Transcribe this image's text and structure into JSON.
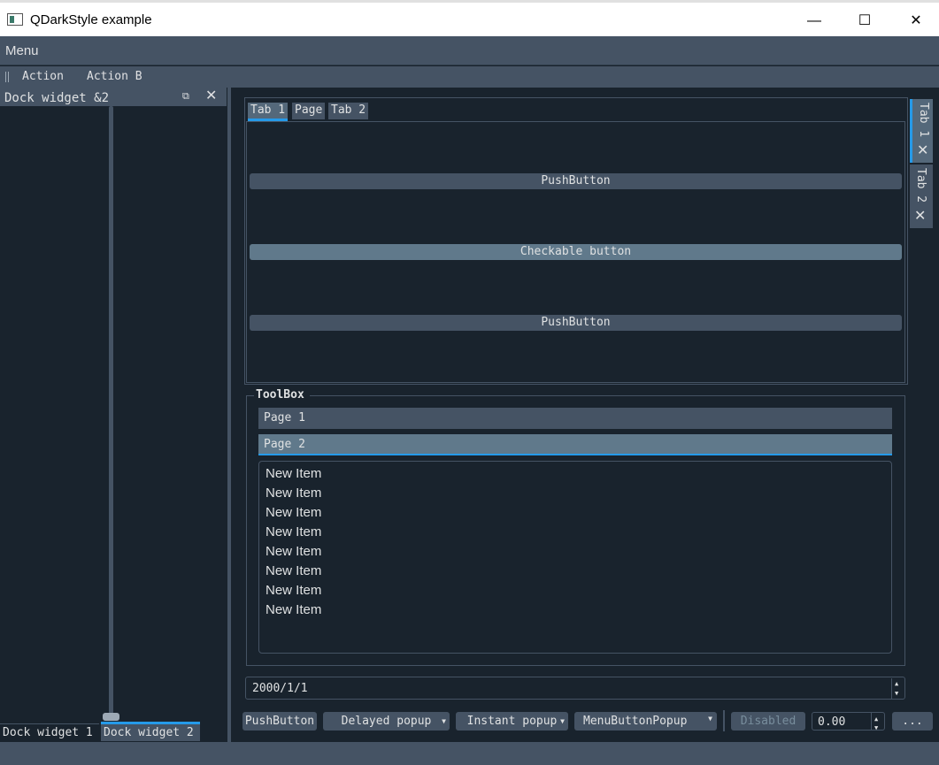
{
  "window": {
    "title": "QDarkStyle example",
    "minimize": "—",
    "maximize": "☐",
    "close": "✕"
  },
  "menubar": {
    "menu": "Menu"
  },
  "toolbar": {
    "actions": [
      "Action",
      "Action B"
    ]
  },
  "dock": {
    "title": "Dock widget &2",
    "float": "⧉",
    "close": "✕",
    "tabs": [
      "Dock widget 1",
      "Dock widget 2"
    ],
    "active_tab": "Dock widget 2",
    "slider_value": 0.0
  },
  "tabwidget": {
    "tabs": [
      "Tab 1",
      "Page",
      "Tab 2"
    ],
    "active_tab": "Tab 1",
    "buttons": [
      "PushButton",
      "Checkable button",
      "PushButton"
    ]
  },
  "vertical_tabs": [
    {
      "label": "Tab 1",
      "close": "✕"
    },
    {
      "label": "Tab 2",
      "close": "✕"
    }
  ],
  "toolbox": {
    "title": "ToolBox",
    "pages": [
      "Page 1",
      "Page 2"
    ],
    "active_page": "Page 2",
    "items": [
      "New Item",
      "New Item",
      "New Item",
      "New Item",
      "New Item",
      "New Item",
      "New Item",
      "New Item"
    ]
  },
  "dateedit": {
    "value": "2000/1/1"
  },
  "bottom_toolbar": {
    "pushbutton": "PushButton",
    "delayed": "Delayed popup",
    "instant": "Instant popup",
    "menubutton": "MenuButtonPopup",
    "disabled": "Disabled",
    "spin_value": "0.00",
    "more": "..."
  },
  "colors": {
    "background": "#19232D",
    "panel": "#455364",
    "accent": "#259AE9",
    "checked": "#60798B"
  }
}
